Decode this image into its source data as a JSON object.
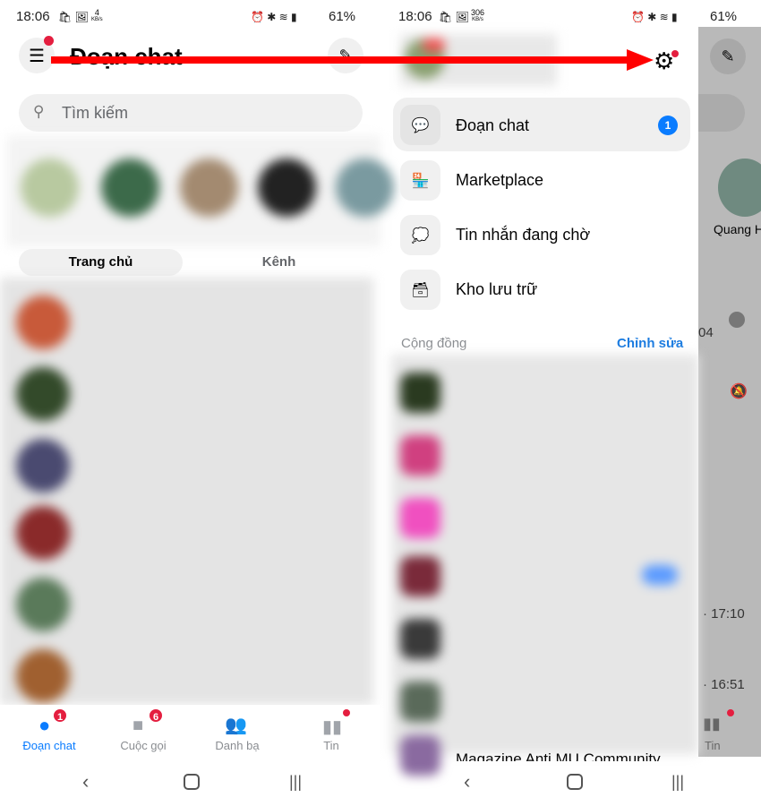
{
  "left": {
    "status": {
      "time": "18:06",
      "speed": "4",
      "speed_unit": "KB/s",
      "battery": "61%"
    },
    "header": {
      "title": "Đoạn chat"
    },
    "search": {
      "placeholder": "Tìm kiếm"
    },
    "tabs": [
      {
        "label": "Trang chủ",
        "active": true
      },
      {
        "label": "Kênh",
        "active": false
      }
    ],
    "bottom_nav": [
      {
        "label": "Đoạn chat",
        "icon": "chat-bubble-icon",
        "badge": "1",
        "active": true
      },
      {
        "label": "Cuộc gọi",
        "icon": "video-call-icon",
        "badge": "6"
      },
      {
        "label": "Danh bạ",
        "icon": "people-icon"
      },
      {
        "label": "Tin",
        "icon": "stories-icon",
        "dot": true
      }
    ]
  },
  "right": {
    "status": {
      "time": "18:06",
      "speed": "306",
      "speed_unit": "KB/s",
      "battery": "61%"
    },
    "menu": [
      {
        "label": "Đoạn chat",
        "icon": "chat-icon",
        "badge": "1",
        "selected": true
      },
      {
        "label": "Marketplace",
        "icon": "store-icon"
      },
      {
        "label": "Tin nhắn đang chờ",
        "icon": "pending-message-icon"
      },
      {
        "label": "Kho lưu trữ",
        "icon": "archive-icon"
      }
    ],
    "community": {
      "title": "Cộng đồng",
      "edit": "Chỉnh sửa"
    },
    "partial_item": "Magazine Anti MU Community",
    "behind": {
      "story_name": "Quang H",
      "time_a": "04",
      "time_b": "· 17:10",
      "time_c": "· 16:51",
      "nav_label": "Tin"
    }
  },
  "colors": {
    "accent": "#0a7cff",
    "badge": "#e41e3f",
    "arrow": "#ff0000"
  }
}
